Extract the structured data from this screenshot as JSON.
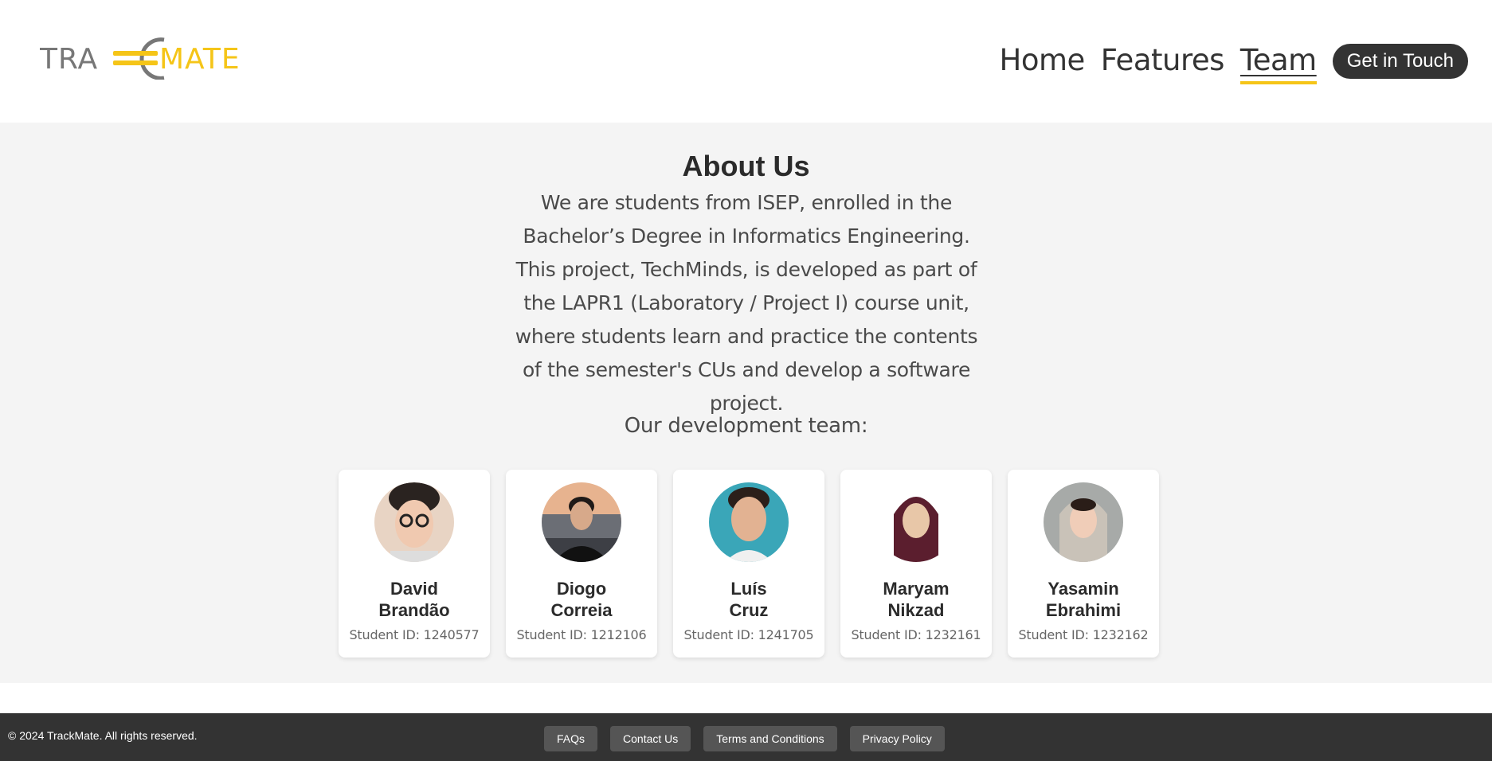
{
  "header": {
    "logo_text_left": "TRA",
    "logo_text_right": "MATE",
    "nav": [
      {
        "label": "Home",
        "active": false
      },
      {
        "label": "Features",
        "active": false
      },
      {
        "label": "Team",
        "active": true
      }
    ],
    "cta_label": "Get in Touch"
  },
  "main": {
    "title": "About Us",
    "description": "We are students from ISEP, enrolled in the Bachelor’s Degree in Informatics Engineering. This project, TechMinds, is developed as part of the LAPR1 (Laboratory / Project I) course unit, where students learn and practice the contents of the semester's CUs and develop a software project.",
    "team_label": "Our development team:",
    "members": [
      {
        "first": "David",
        "last": "Brandão",
        "student_id": "Student ID: 1240577"
      },
      {
        "first": "Diogo",
        "last": "Correia",
        "student_id": "Student ID: 1212106"
      },
      {
        "first": "Luís",
        "last": "Cruz",
        "student_id": "Student ID: 1241705"
      },
      {
        "first": "Maryam",
        "last": "Nikzad",
        "student_id": "Student ID: 1232161"
      },
      {
        "first": "Yasamin",
        "last": "Ebrahimi",
        "student_id": "Student ID: 1232162"
      }
    ]
  },
  "footer": {
    "copyright": "© 2024 TrackMate. All rights reserved.",
    "links": [
      "FAQs",
      "Contact Us",
      "Terms and Conditions",
      "Privacy Policy"
    ]
  },
  "colors": {
    "accent": "#f5c518",
    "logo_gray": "#777777",
    "dark": "#333333",
    "section_bg": "#f4f4f4"
  }
}
